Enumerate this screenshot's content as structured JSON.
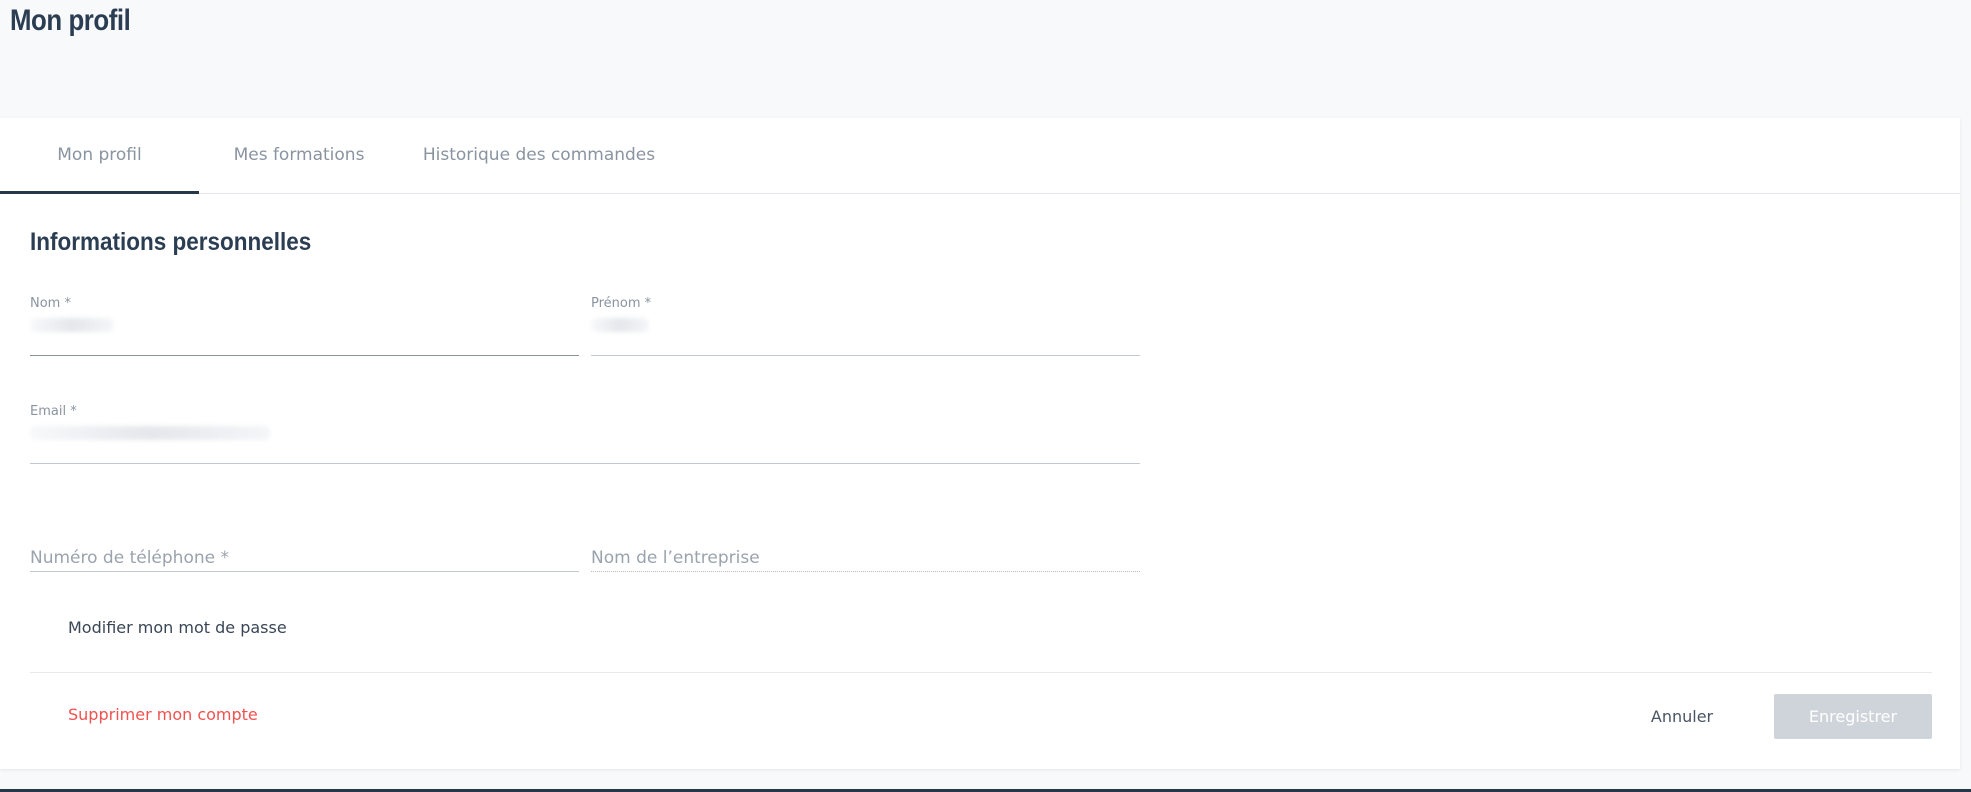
{
  "page": {
    "title": "Mon profil"
  },
  "tabs": [
    {
      "label": "Mon profil",
      "active": true
    },
    {
      "label": "Mes formations",
      "active": false
    },
    {
      "label": "Historique des commandes",
      "active": false
    }
  ],
  "section": {
    "title": "Informations personnelles"
  },
  "form": {
    "nom": {
      "label": "Nom *"
    },
    "prenom": {
      "label": "Prénom *"
    },
    "email": {
      "label": "Email *"
    },
    "telephone": {
      "placeholder": "Numéro de téléphone *"
    },
    "entreprise": {
      "placeholder": "Nom de l’entreprise"
    }
  },
  "links": {
    "change_password": "Modifier mon mot de passe",
    "delete_account": "Supprimer mon compte"
  },
  "actions": {
    "cancel_label": "Annuler",
    "save_label": "Enregistrer"
  },
  "colors": {
    "heading": "#2b3d52",
    "tab_active_border": "#263748",
    "danger": "#f0524f",
    "save_disabled_bg": "#cfd4da"
  }
}
